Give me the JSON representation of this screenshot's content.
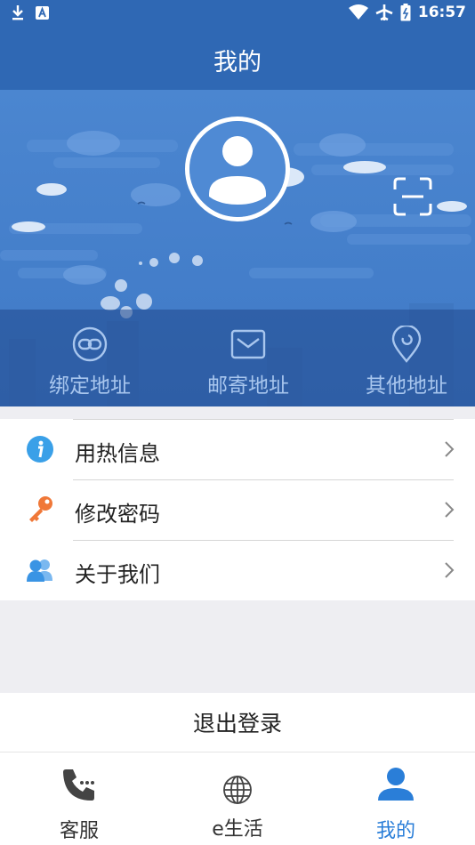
{
  "status_bar": {
    "time": "16:57",
    "icons": [
      "download-icon",
      "a-badge-icon",
      "wifi-icon",
      "airplane-icon",
      "battery-icon"
    ]
  },
  "header": {
    "title": "我的"
  },
  "banner": {
    "avatar_icon": "user-avatar-icon",
    "scan_icon": "scan-icon",
    "shortcuts": [
      {
        "label": "绑定地址",
        "icon": "link-icon"
      },
      {
        "label": "邮寄地址",
        "icon": "mail-icon"
      },
      {
        "label": "其他地址",
        "icon": "location-pin-icon"
      }
    ]
  },
  "menu": {
    "items": [
      {
        "label": "用热信息",
        "icon": "info-icon"
      },
      {
        "label": "修改密码",
        "icon": "key-icon"
      },
      {
        "label": "关于我们",
        "icon": "users-icon"
      }
    ]
  },
  "logout": {
    "label": "退出登录"
  },
  "bottom_nav": {
    "items": [
      {
        "label": "客服",
        "icon": "phone-icon"
      },
      {
        "label": "e生活",
        "icon": "globe-icon"
      },
      {
        "label": "我的",
        "icon": "user-icon",
        "active": true
      }
    ]
  },
  "colors": {
    "primary": "#2f68b4",
    "banner": "#4582cc",
    "accent_active": "#2a7ed8",
    "info_icon": "#3aa0e8",
    "key_icon": "#f07838",
    "users_icon": "#4aa0e8"
  }
}
